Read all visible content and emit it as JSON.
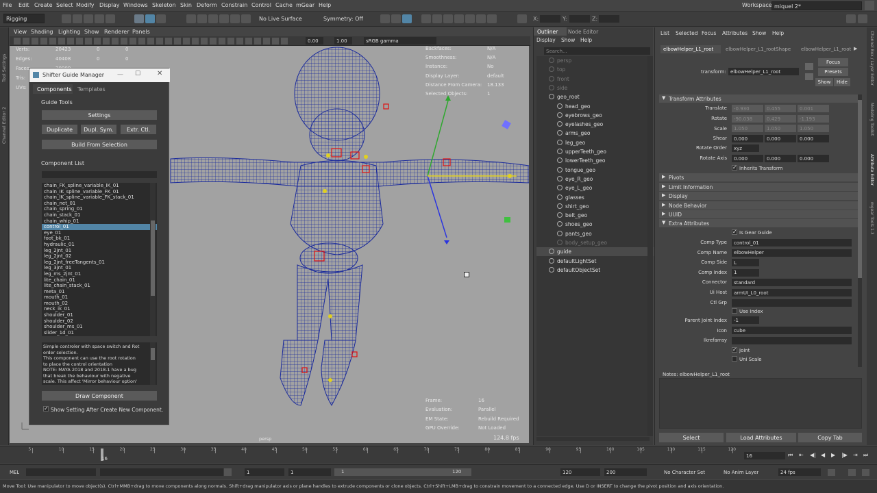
{
  "menubar": {
    "items": [
      "File",
      "Edit",
      "Create",
      "Select",
      "Modify",
      "Display",
      "Windows",
      "Skeleton",
      "Skin",
      "Deform",
      "Constrain",
      "Control",
      "Cache",
      "mGear",
      "Help"
    ],
    "workspace_label": "Workspace :",
    "workspace_value": "miquel 2*"
  },
  "shelf": {
    "mode": "Rigging",
    "no_live_surface": "No Live Surface",
    "symmetry": "Symmetry: Off",
    "x_label": "X:",
    "y_label": "Y:",
    "z_label": "Z:"
  },
  "left_strip_labels": [
    "Tool Settings",
    "Channel Editor 2"
  ],
  "viewport": {
    "menu": [
      "View",
      "Shading",
      "Lighting",
      "Show",
      "Renderer",
      "Panels"
    ],
    "field1": "0.00",
    "field2": "1.00",
    "colorspace": "sRGB gamma",
    "stats": [
      {
        "label": "Verts:",
        "a": "20423",
        "b": "0",
        "c": "0"
      },
      {
        "label": "Edges:",
        "a": "40408",
        "b": "0",
        "c": "0"
      },
      {
        "label": "Faces:",
        "a": "20009",
        "b": "0",
        "c": "0"
      },
      {
        "label": "Tris:",
        "a": "",
        "b": "",
        "c": ""
      },
      {
        "label": "UVs:",
        "a": "",
        "b": "",
        "c": ""
      }
    ],
    "hud_right": [
      {
        "label": "Backfaces:",
        "value": "N/A"
      },
      {
        "label": "Smoothness:",
        "value": "N/A"
      },
      {
        "label": "Instance:",
        "value": "No"
      },
      {
        "label": "Display Layer:",
        "value": "default"
      },
      {
        "label": "Distance From Camera:",
        "value": "18.133"
      },
      {
        "label": "Selected Objects:",
        "value": "1"
      }
    ],
    "hud_bottom": [
      {
        "label": "Frame:",
        "value": "16"
      },
      {
        "label": "Evaluation:",
        "value": "Parallel"
      },
      {
        "label": "EM State:",
        "value": "Rebuild Required"
      },
      {
        "label": "GPU Override:",
        "value": "Not Loaded"
      }
    ],
    "fps": "124.8 fps",
    "camera": "persp"
  },
  "shifter": {
    "title": "Shifter Guide Manager",
    "tabs": [
      "Components",
      "Templates"
    ],
    "guide_tools": "Guide Tools",
    "settings": "Settings",
    "duplicate": "Duplicate",
    "dupl_sym": "Dupl. Sym.",
    "extr_ctl": "Extr. Ctl.",
    "build_from_selection": "Build From Selection",
    "component_list": "Component List",
    "components": [
      "chain_FK_spline_variable_IK_01",
      "chain_IK_spline_variable_FK_01",
      "chain_IK_spline_variable_FK_stack_01",
      "chain_net_01",
      "chain_spring_01",
      "chain_stack_01",
      "chain_whip_01",
      "control_01",
      "eye_01",
      "foot_bk_01",
      "hydraulic_01",
      "leg_2jnt_01",
      "leg_2jnt_02",
      "leg_2jnt_freeTangents_01",
      "leg_3jnt_01",
      "leg_ms_2jnt_01",
      "lite_chain_01",
      "lite_chain_stack_01",
      "meta_01",
      "mouth_01",
      "mouth_02",
      "neck_ik_01",
      "shoulder_01",
      "shoulder_02",
      "shoulder_ms_01",
      "slider_1d_01"
    ],
    "selected_index": 7,
    "description": [
      "Simple controler with space switch and Rot",
      "order selection.",
      "This component can use the root rotation",
      "to place  the control orientation",
      "NOTE: MAYA 2018 and 2018.1 have a bug",
      "that break the behaviour with negative",
      "scale. This affect 'Mirror behaviour option'"
    ],
    "draw_component": "Draw Component",
    "show_setting": "Show Setting After Create New Component."
  },
  "outliner": {
    "tabs": [
      "Outliner",
      "Node Editor"
    ],
    "menu": [
      "Display",
      "Show",
      "Help"
    ],
    "search_placeholder": "Search...",
    "items": [
      {
        "label": "persp",
        "indent": 0,
        "dim": true
      },
      {
        "label": "top",
        "indent": 0,
        "dim": true
      },
      {
        "label": "front",
        "indent": 0,
        "dim": true
      },
      {
        "label": "side",
        "indent": 0,
        "dim": true
      },
      {
        "label": "geo_root",
        "indent": 0,
        "dim": false
      },
      {
        "label": "head_geo",
        "indent": 1,
        "dim": false
      },
      {
        "label": "eyebrows_geo",
        "indent": 1,
        "dim": false
      },
      {
        "label": "eyelashes_geo",
        "indent": 1,
        "dim": false
      },
      {
        "label": "arms_geo",
        "indent": 1,
        "dim": false
      },
      {
        "label": "leg_geo",
        "indent": 1,
        "dim": false
      },
      {
        "label": "upperTeeth_geo",
        "indent": 1,
        "dim": false
      },
      {
        "label": "lowerTeeth_geo",
        "indent": 1,
        "dim": false
      },
      {
        "label": "tongue_geo",
        "indent": 1,
        "dim": false
      },
      {
        "label": "eye_R_geo",
        "indent": 1,
        "dim": false
      },
      {
        "label": "eye_L_geo",
        "indent": 1,
        "dim": false
      },
      {
        "label": "glasses",
        "indent": 1,
        "dim": false
      },
      {
        "label": "shirt_geo",
        "indent": 1,
        "dim": false
      },
      {
        "label": "belt_geo",
        "indent": 1,
        "dim": false
      },
      {
        "label": "shoes_geo",
        "indent": 1,
        "dim": false
      },
      {
        "label": "pants_geo",
        "indent": 1,
        "dim": false
      },
      {
        "label": "body_setup_geo",
        "indent": 1,
        "dim": true
      },
      {
        "label": "guide",
        "indent": 0,
        "dim": false
      },
      {
        "label": "defaultLightSet",
        "indent": 0,
        "dim": false
      },
      {
        "label": "defaultObjectSet",
        "indent": 0,
        "dim": false
      }
    ]
  },
  "attr": {
    "menu": [
      "List",
      "Selected",
      "Focus",
      "Attributes",
      "Show",
      "Help"
    ],
    "tabs": [
      "elbowHelper_L1_root",
      "elbowHelper_L1_rootShape",
      "elbowHelper_L1_root"
    ],
    "transform_label": "transform:",
    "transform_value": "elbowHelper_L1_root",
    "focus": "Focus",
    "presets": "Presets",
    "show": "Show",
    "hide": "Hide",
    "transform_attributes": "Transform Attributes",
    "translate": {
      "label": "Translate",
      "x": "-0.930",
      "y": "0.455",
      "z": "0.001"
    },
    "rotate": {
      "label": "Rotate",
      "x": "-90.038",
      "y": "0.429",
      "z": "-1.193"
    },
    "scale": {
      "label": "Scale",
      "x": "1.050",
      "y": "1.050",
      "z": "1.050"
    },
    "shear": {
      "label": "Shear",
      "x": "0.000",
      "y": "0.000",
      "z": "0.000"
    },
    "rotate_order_label": "Rotate Order",
    "rotate_order": "xyz",
    "rotate_axis": {
      "label": "Rotate Axis",
      "x": "0.000",
      "y": "0.000",
      "z": "0.000"
    },
    "inherits_transform": "Inherits Transform",
    "sections": [
      "Pivots",
      "Limit Information",
      "Display",
      "Node Behavior",
      "UUID",
      "Extra Attributes"
    ],
    "is_gear_guide": "Is Gear Guide",
    "extra": [
      {
        "label": "Comp Type",
        "value": "control_01"
      },
      {
        "label": "Comp Name",
        "value": "elbowHelper"
      },
      {
        "label": "Comp Side",
        "value": "L"
      },
      {
        "label": "Comp Index",
        "value": "1"
      },
      {
        "label": "Connector",
        "value": "standard"
      },
      {
        "label": "Ui Host",
        "value": "armUI_L0_root"
      },
      {
        "label": "Ctl Grp",
        "value": ""
      }
    ],
    "use_index": "Use Index",
    "parent_joint_index_label": "Parent Joint Index",
    "parent_joint_index": "-1",
    "icon_label": "Icon",
    "icon_value": "cube",
    "ikrefarray_label": "Ikrefarray",
    "joint": "Joint",
    "uni_scale": "Uni Scale",
    "notes_label": "Notes:  elbowHelper_L1_root",
    "select": "Select",
    "load_attributes": "Load Attributes",
    "copy_tab": "Copy Tab"
  },
  "right_strip_labels": [
    "Channel Box / Layer Editor",
    "Modeling Toolkit",
    "Attribute Editor",
    "mgear Tools 1.3"
  ],
  "timeline": {
    "ticks": [
      "5",
      "10",
      "15",
      "20",
      "25",
      "30",
      "35",
      "40",
      "45",
      "50",
      "55",
      "60",
      "65",
      "70",
      "75",
      "80",
      "85",
      "90",
      "95",
      "100",
      "105",
      "110",
      "115",
      "120"
    ],
    "current_marker": "16",
    "current_frame": "16"
  },
  "range": {
    "mel": "MEL",
    "start1": "1",
    "start2": "1",
    "slider_start": "1",
    "slider_end": "120",
    "end1": "120",
    "end2": "200",
    "no_character_set": "No Character Set",
    "no_anim_layer": "No Anim Layer",
    "fps": "24 fps"
  },
  "status": "Move Tool: Use manipulator to move object(s). Ctrl+MMB+drag to move components along normals. Shift+drag manipulator axis or plane handles to extrude components or clone objects. Ctrl+Shift+LMB+drag to constrain movement to a connected edge. Use D or INSERT to change the pivot position and axis orientation.",
  "colors": {
    "selection": "#5285a6",
    "wire": "#1a2a9c",
    "viewport_bg": "#a2a2a2",
    "panel": "#444444"
  }
}
